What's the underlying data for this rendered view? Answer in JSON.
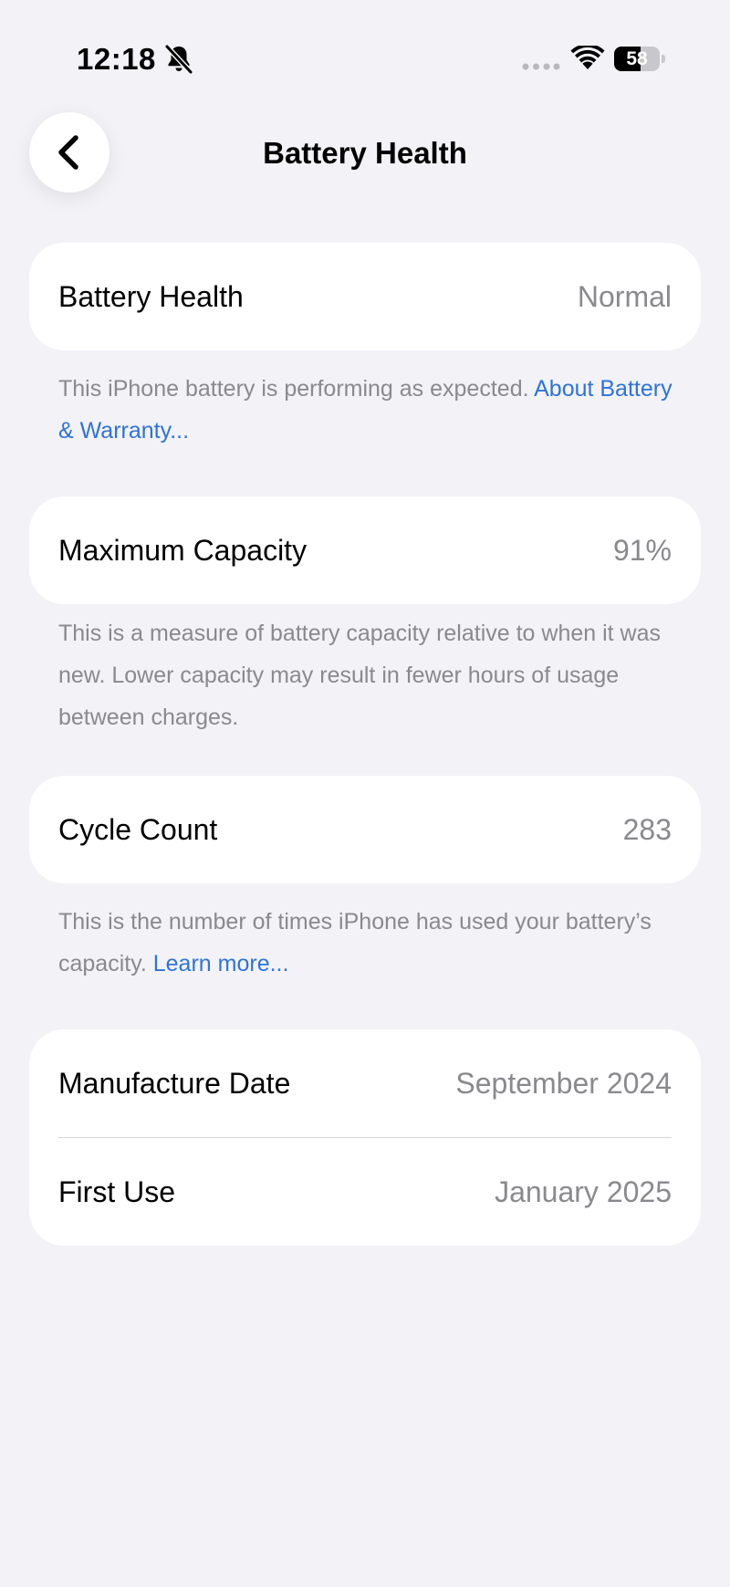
{
  "status_bar": {
    "time": "12:18",
    "battery_level": "58",
    "battery_fraction": 0.58,
    "icons": [
      "bell-slash-icon",
      "cellular-signal-icon",
      "wifi-icon",
      "battery-icon"
    ]
  },
  "nav": {
    "title": "Battery Health",
    "back_icon": "chevron-left-icon"
  },
  "battery_health": {
    "label": "Battery Health",
    "value": "Normal",
    "footnote_text": "This iPhone battery is performing as expected. ",
    "footnote_link": "About Battery & Warranty..."
  },
  "max_capacity": {
    "label": "Maximum Capacity",
    "value": "91%",
    "footnote_text": "This is a measure of battery capacity relative to when it was new. Lower capacity may result in fewer hours of usage between charges."
  },
  "cycle_count": {
    "label": "Cycle Count",
    "value": "283",
    "footnote_text": "This is the number of times iPhone has used your battery’s capacity. ",
    "footnote_link": "Learn more..."
  },
  "dates": {
    "manufacture_label": "Manufacture Date",
    "manufacture_value": "September 2024",
    "first_use_label": "First Use",
    "first_use_value": "January 2025"
  },
  "colors": {
    "background": "#f2f2f7",
    "card": "#ffffff",
    "secondary_text": "#8a8a8e",
    "link": "#2f73d9"
  }
}
